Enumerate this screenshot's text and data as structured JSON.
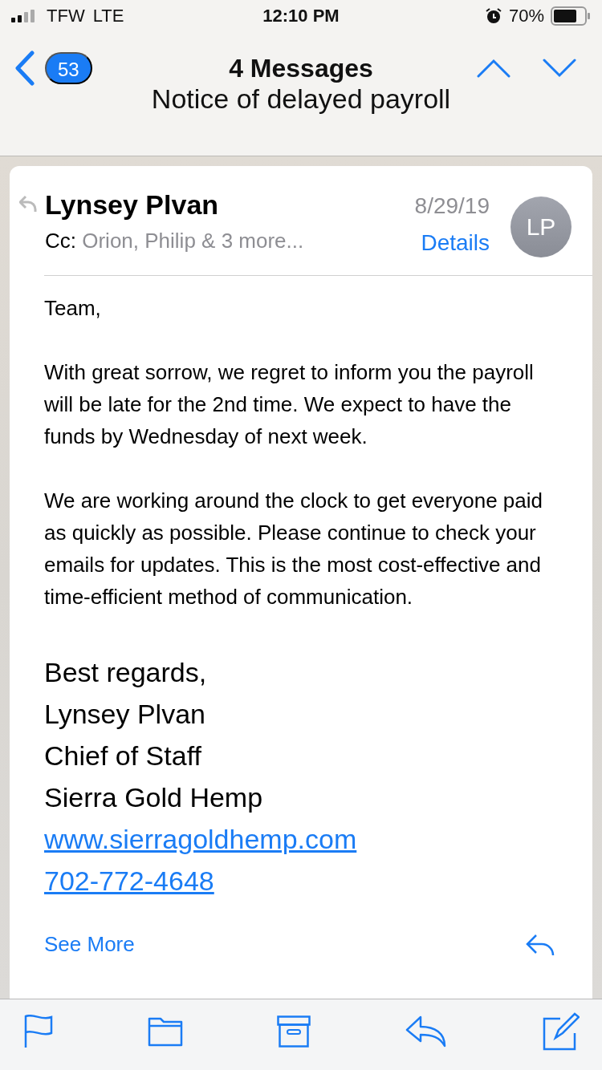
{
  "status_bar": {
    "carrier": "TFW",
    "network": "LTE",
    "time": "12:10 PM",
    "battery": "70%"
  },
  "nav": {
    "back_count": "53",
    "title": "4 Messages",
    "subject": "Notice of delayed payroll"
  },
  "message": {
    "sender": "Lynsey Plvan",
    "date": "8/29/19",
    "cc_label": "Cc:",
    "cc": "Orion, Philip & 3 more...",
    "details": "Details",
    "avatar": "LP",
    "paragraphs": [
      "Team,",
      "With great sorrow, we regret to inform you the payroll will be late for the 2nd time. We expect to have the funds by Wednesday of next week.",
      "We are working around the clock to get everyone paid as quickly as possible. Please continue to check your emails for updates. This is the most cost-effective and time-efficient method of communication."
    ],
    "signature": [
      {
        "kind": "text",
        "text": "Best regards,"
      },
      {
        "kind": "text",
        "text": "Lynsey Plvan"
      },
      {
        "kind": "text",
        "text": "Chief of Staff"
      },
      {
        "kind": "text",
        "text": "Sierra Gold Hemp"
      },
      {
        "kind": "link",
        "text": "www.sierragoldhemp.com"
      },
      {
        "kind": "link",
        "text": "702-772-4648"
      }
    ],
    "see_more": "See More"
  }
}
